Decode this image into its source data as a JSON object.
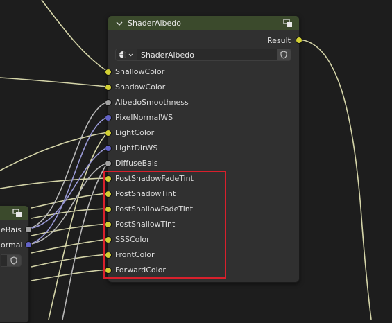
{
  "main_node": {
    "title": "ShaderAlbedo",
    "output_label": "Result",
    "shader_field": "ShaderAlbedo",
    "inputs": [
      {
        "label": "ShallowColor",
        "color": "yellow"
      },
      {
        "label": "ShadowColor",
        "color": "yellow"
      },
      {
        "label": "AlbedoSmoothness",
        "color": "gray"
      },
      {
        "label": "PixelNormalWS",
        "color": "blue"
      },
      {
        "label": "LightColor",
        "color": "yellow"
      },
      {
        "label": "LightDirWS",
        "color": "blue"
      },
      {
        "label": "DiffuseBais",
        "color": "gray"
      },
      {
        "label": "PostShadowFadeTint",
        "color": "yellow"
      },
      {
        "label": "PostShadowTint",
        "color": "yellow"
      },
      {
        "label": "PostShallowFadeTint",
        "color": "yellow"
      },
      {
        "label": "PostShallowTint",
        "color": "yellow"
      },
      {
        "label": "SSSColor",
        "color": "yellow"
      },
      {
        "label": "FrontColor",
        "color": "yellow"
      },
      {
        "label": "ForwardColor",
        "color": "yellow"
      }
    ]
  },
  "left_node": {
    "outputs": [
      "eBais",
      "ormal"
    ]
  },
  "colors": {
    "socket_yellow": "#d2d034",
    "socket_gray": "#a1a1a1",
    "socket_blue": "#6363c7",
    "header_green": "#3b4a2c",
    "highlight": "#d8202c"
  }
}
